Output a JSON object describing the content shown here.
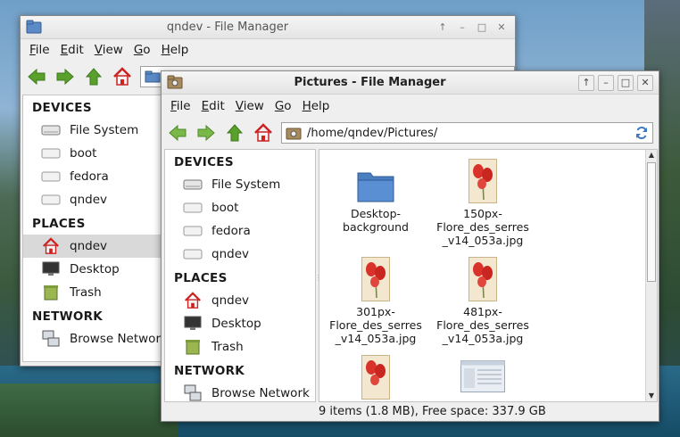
{
  "back_window": {
    "title": "qndev - File Manager",
    "menu": [
      "File",
      "Edit",
      "View",
      "Go",
      "Help"
    ],
    "sidebar": {
      "devices_heading": "DEVICES",
      "devices": [
        "File System",
        "boot",
        "fedora",
        "qndev"
      ],
      "places_heading": "PLACES",
      "places": [
        "qndev",
        "Desktop",
        "Trash"
      ],
      "network_heading": "NETWORK",
      "network": [
        "Browse Network"
      ]
    }
  },
  "front_window": {
    "title": "Pictures - File Manager",
    "menu": [
      "File",
      "Edit",
      "View",
      "Go",
      "Help"
    ],
    "location": "/home/qndev/Pictures/",
    "sidebar": {
      "devices_heading": "DEVICES",
      "devices": [
        "File System",
        "boot",
        "fedora",
        "qndev"
      ],
      "places_heading": "PLACES",
      "places": [
        "qndev",
        "Desktop",
        "Trash"
      ],
      "network_heading": "NETWORK",
      "network": [
        "Browse Network"
      ]
    },
    "files": [
      {
        "name": "Desktop-\nbackground",
        "icon": "folder-icon"
      },
      {
        "name": "150px-\nFlore_des_serres\n_v14_053a.jpg",
        "icon": "flower-thumbnail-icon"
      },
      {
        "name": "301px-\nFlore_des_serres\n_v14_053a.jpg",
        "icon": "flower-thumbnail-icon"
      },
      {
        "name": "481px-\nFlore_des_serres\n_v14_053a.jpg",
        "icon": "flower-thumbnail-icon"
      },
      {
        "name": "",
        "icon": "flower-thumbnail-icon"
      },
      {
        "name": "",
        "icon": "screenshot-thumbnail-icon"
      }
    ],
    "status": "9 items (1.8 MB), Free space: 337.9 GB"
  },
  "colors": {
    "nav_green": "#5aa02c",
    "home_red": "#cc2222",
    "folder_blue": "#4a7fc1",
    "selection": "#d9d9d9"
  }
}
